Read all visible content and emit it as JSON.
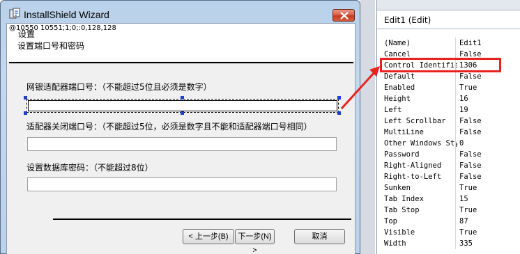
{
  "window": {
    "title": "InstallShield Wizard",
    "debug_text": "@10550 10551;1;0;:0,128,128",
    "heading": "设置",
    "subheading": "设置端口号和密码"
  },
  "fields": {
    "port_label": "网银适配器端口号：（不能超过5位且必须是数字）",
    "port_value": "",
    "close_port_label": "适配器关闭端口号：（不能超过5位，必须是数字且不能和适配器端口号相同）",
    "close_port_value": "",
    "db_password_label": "设置数据库密码：（不能超过8位）",
    "db_password_value": ""
  },
  "buttons": {
    "back": "< 上一步(B)",
    "next": "下一步(N) >",
    "cancel": "取消"
  },
  "properties": {
    "title": "Edit1 (Edit)",
    "rows": [
      {
        "name": "(Name)",
        "value": "Edit1"
      },
      {
        "name": "Cancel",
        "value": "False"
      },
      {
        "name": "Control Identifie",
        "value": "1306"
      },
      {
        "name": "Default",
        "value": "False"
      },
      {
        "name": "Enabled",
        "value": "True"
      },
      {
        "name": "Height",
        "value": "16"
      },
      {
        "name": "Left",
        "value": "19"
      },
      {
        "name": "Left Scrollbar",
        "value": "False"
      },
      {
        "name": "MultiLine",
        "value": "False"
      },
      {
        "name": "Other Windows Sty",
        "value": "0"
      },
      {
        "name": "Password",
        "value": "False"
      },
      {
        "name": "Right-Aligned",
        "value": "False"
      },
      {
        "name": "Right-to-Left",
        "value": "False"
      },
      {
        "name": "Sunken",
        "value": "True"
      },
      {
        "name": "Tab Index",
        "value": "15"
      },
      {
        "name": "Tab Stop",
        "value": "True"
      },
      {
        "name": "Top",
        "value": "87"
      },
      {
        "name": "Visible",
        "value": "True"
      },
      {
        "name": "Width",
        "value": "335"
      }
    ]
  },
  "colors": {
    "highlight": "#e8231f",
    "selection_handle": "#1e3fd0"
  }
}
